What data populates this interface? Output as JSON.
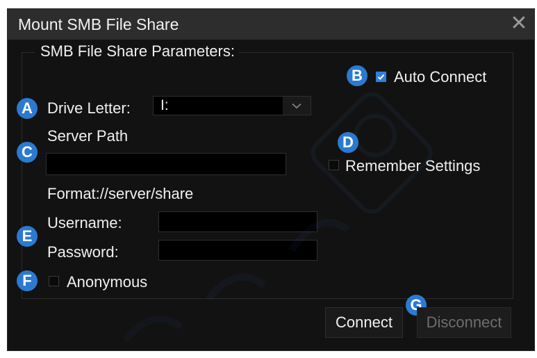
{
  "dialog": {
    "title": "Mount SMB File Share",
    "close_glyph": "✕"
  },
  "group": {
    "title": "SMB File Share Parameters:"
  },
  "fields": {
    "drive_letter_label": "Drive Letter:",
    "drive_letter_value": "I:",
    "server_path_label": "Server Path",
    "server_path_value": "",
    "format_hint": "Format://server/share",
    "username_label": "Username:",
    "username_value": "",
    "password_label": "Password:",
    "password_value": ""
  },
  "options": {
    "auto_connect_label": "Auto Connect",
    "auto_connect_checked": true,
    "remember_settings_label": "Remember Settings",
    "remember_settings_checked": false,
    "anonymous_label": "Anonymous",
    "anonymous_checked": false
  },
  "buttons": {
    "connect": "Connect",
    "disconnect": "Disconnect"
  },
  "badges": [
    "A",
    "B",
    "C",
    "D",
    "E",
    "F",
    "G"
  ],
  "colors": {
    "badge": "#2b7ad0",
    "checkbox_checked": "#2f7fd8",
    "dialog_bg": "#121212",
    "titlebar_bg": "#2d2d2d"
  }
}
